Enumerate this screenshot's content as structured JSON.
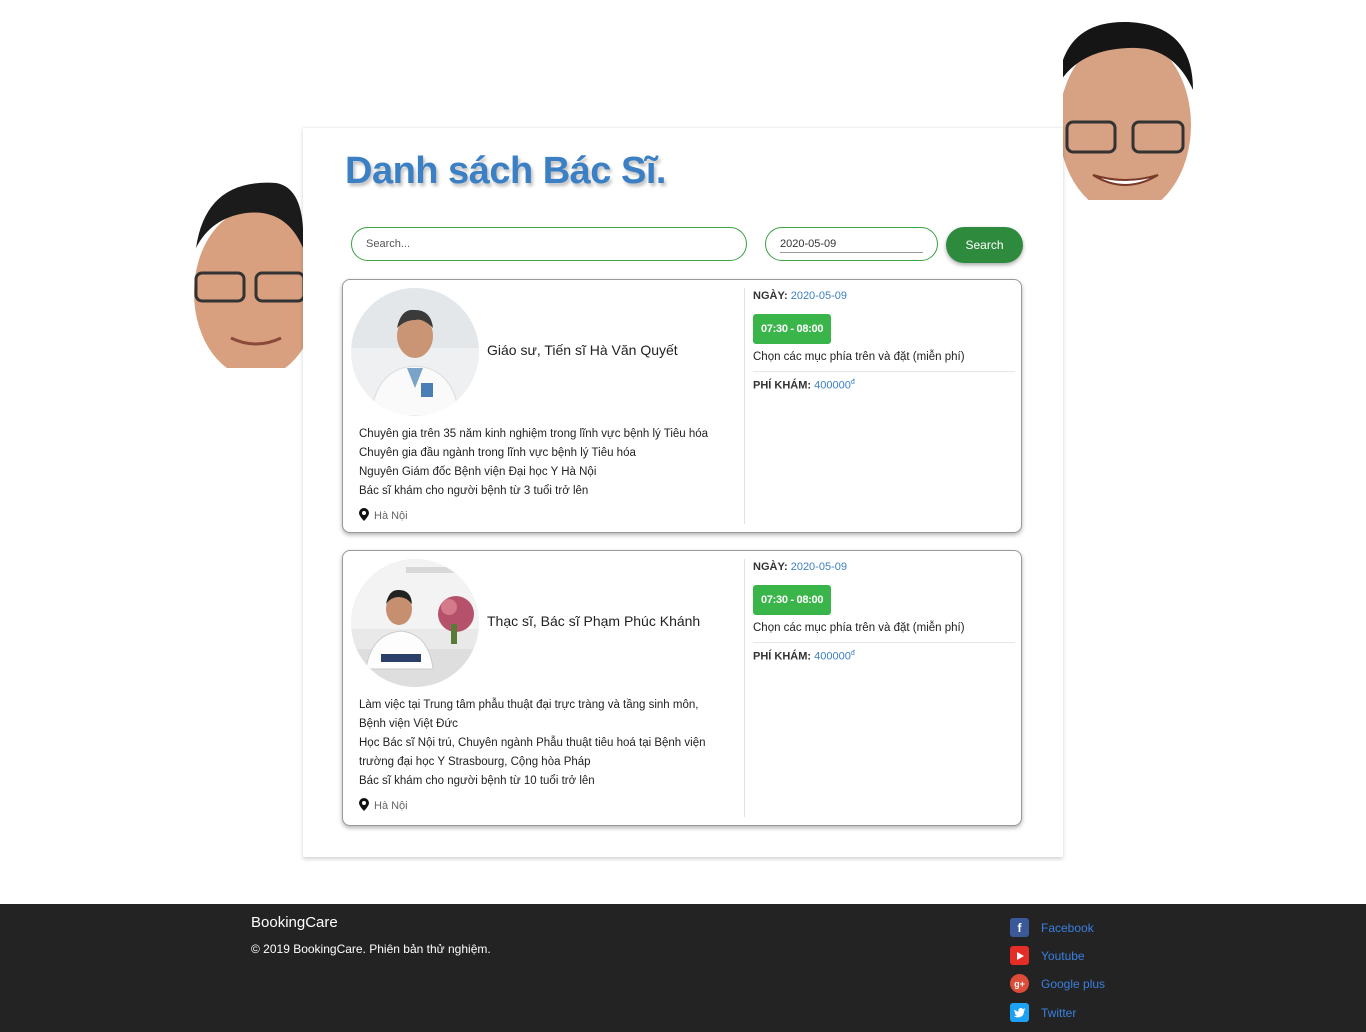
{
  "page": {
    "title": "Danh sách Bác Sĩ."
  },
  "search": {
    "placeholder": "Search...",
    "date_value": "2020-05-09",
    "button_label": "Search"
  },
  "doctors": [
    {
      "name": "Giáo sư, Tiến sĩ Hà Văn Quyết",
      "description": [
        "Chuyên gia trên 35 năm kinh nghiệm trong lĩnh vực bệnh lý Tiêu hóa",
        "Chuyên gia đầu ngành trong lĩnh vực bệnh lý Tiêu hóa",
        "Nguyên Giám đốc Bệnh viện Đại học Y Hà Nội",
        "Bác sĩ khám cho người bệnh từ 3 tuổi trở lên"
      ],
      "location": "Hà Nội",
      "date_label": "NGÀY:",
      "date": "2020-05-09",
      "slot": "07:30 - 08:00",
      "hint": "Chọn các mục phía trên và đặt (miễn phí)",
      "fee_label": "PHÍ KHÁM:",
      "fee": "400000",
      "currency": "đ"
    },
    {
      "name": "Thạc sĩ, Bác sĩ Phạm Phúc Khánh",
      "description": [
        "Làm việc tại Trung tâm phẫu thuật đại trực tràng và tầng sinh môn,",
        "Bệnh viện Việt Đức",
        "Học Bác sĩ Nội trú, Chuyên ngành Phẫu thuật tiêu hoá tại Bệnh viện",
        "trường đại học Y Strasbourg, Cộng hòa Pháp",
        "Bác sĩ khám cho người bệnh từ 10 tuổi trở lên"
      ],
      "location": "Hà Nội",
      "date_label": "NGÀY:",
      "date": "2020-05-09",
      "slot": "07:30 - 08:00",
      "hint": "Chọn các mục phía trên và đặt (miễn phí)",
      "fee_label": "PHÍ KHÁM:",
      "fee": "400000",
      "currency": "đ"
    }
  ],
  "footer": {
    "brand": "BookingCare",
    "copyright": "© 2019 BookingCare. Phiên bản thử nghiệm.",
    "social": [
      {
        "label": "Facebook",
        "icon": "facebook-icon",
        "color": "#3b5998"
      },
      {
        "label": "Youtube",
        "icon": "youtube-icon",
        "color": "#e52d27"
      },
      {
        "label": "Google plus",
        "icon": "google-plus-icon",
        "color": "#dd4b39"
      },
      {
        "label": "Twitter",
        "icon": "twitter-icon",
        "color": "#1da1f2"
      }
    ]
  },
  "colors": {
    "accent": "#3b7fc4",
    "button_green": "#2e8b3e",
    "slot_green": "#3ab54a",
    "footer_bg": "#232323",
    "link_blue": "#3b7fe0"
  }
}
